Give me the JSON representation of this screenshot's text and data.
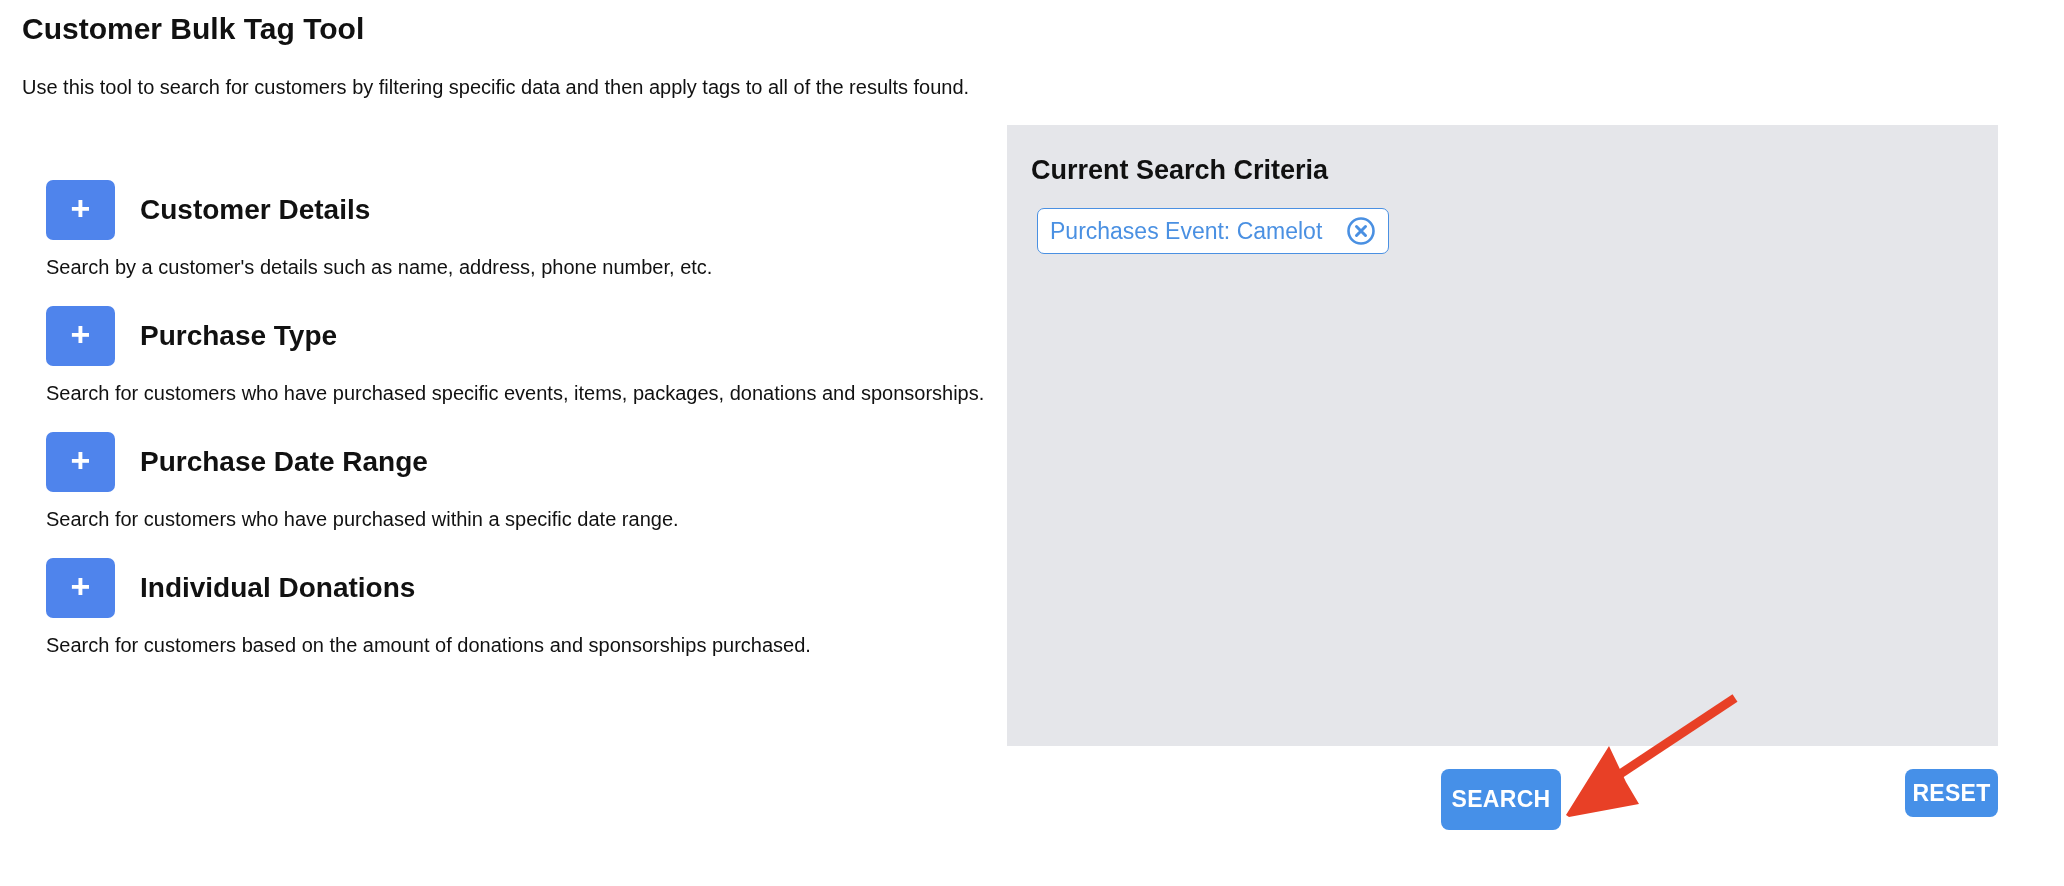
{
  "page": {
    "title": "Customer Bulk Tag Tool",
    "description": "Use this tool to search for customers by filtering specific data and then apply tags to all of the results found."
  },
  "filters": [
    {
      "add_button": "+",
      "heading": "Customer Details",
      "description": "Search by a customer's details such as name, address, phone number, etc."
    },
    {
      "add_button": "+",
      "heading": "Purchase Type",
      "description": "Search for customers who have purchased specific events, items, packages, donations and sponsorships."
    },
    {
      "add_button": "+",
      "heading": "Purchase Date Range",
      "description": "Search for customers who have purchased within a specific date range."
    },
    {
      "add_button": "+",
      "heading": "Individual Donations",
      "description": "Search for customers based on the amount of donations and sponsorships purchased."
    }
  ],
  "criteria": {
    "title": "Current Search Criteria",
    "tags": [
      {
        "label": "Purchases Event: Camelot"
      }
    ]
  },
  "buttons": {
    "search": "SEARCH",
    "reset": "RESET"
  }
}
